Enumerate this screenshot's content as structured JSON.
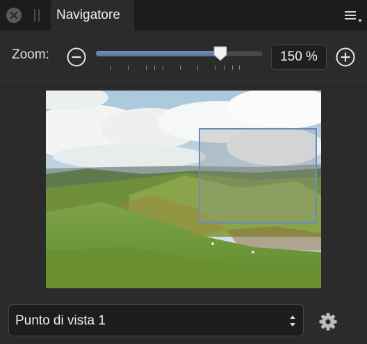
{
  "panel": {
    "tab_title": "Navigatore"
  },
  "zoom": {
    "label": "Zoom:",
    "value_text": "150 %",
    "slider_fraction": 0.75
  },
  "view": {
    "selected": "Punto di vista 1"
  },
  "colors": {
    "accent": "#6b8cb8",
    "panel_bg": "#2b2b2b",
    "titlebar_bg": "#1c1c1c"
  },
  "icons": {
    "close": "close-icon",
    "menu": "hamburger-menu-icon",
    "zoom_out": "zoom-out-icon",
    "zoom_in": "zoom-in-icon",
    "select": "chevron-updown-icon",
    "settings": "gear-icon"
  }
}
